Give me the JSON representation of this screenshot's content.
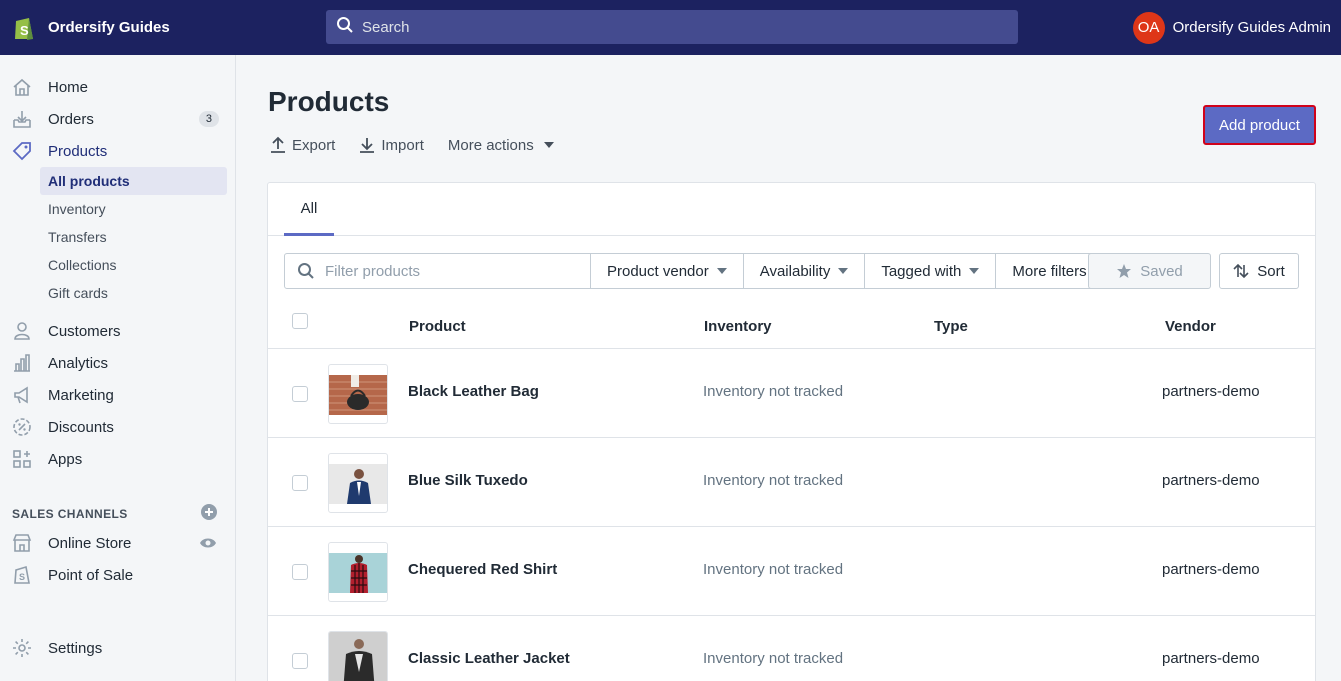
{
  "topbar": {
    "store_name": "Ordersify Guides",
    "search_placeholder": "Search",
    "avatar_initials": "OA",
    "user_name": "Ordersify Guides Admin"
  },
  "sidebar": {
    "items": [
      {
        "label": "Home",
        "icon": "home-icon"
      },
      {
        "label": "Orders",
        "icon": "orders-icon",
        "badge": "3"
      },
      {
        "label": "Products",
        "icon": "tag-icon"
      },
      {
        "label": "Customers",
        "icon": "person-icon"
      },
      {
        "label": "Analytics",
        "icon": "bar-chart-icon"
      },
      {
        "label": "Marketing",
        "icon": "megaphone-icon"
      },
      {
        "label": "Discounts",
        "icon": "discount-icon"
      },
      {
        "label": "Apps",
        "icon": "apps-icon"
      }
    ],
    "product_sub_items": [
      "All products",
      "Inventory",
      "Transfers",
      "Collections",
      "Gift cards"
    ],
    "sales_channels_title": "SALES CHANNELS",
    "channels": [
      {
        "label": "Online Store",
        "icon": "store-icon"
      },
      {
        "label": "Point of Sale",
        "icon": "pos-icon"
      }
    ],
    "settings_label": "Settings"
  },
  "main": {
    "title": "Products",
    "actions": {
      "export": "Export",
      "import": "Import",
      "more": "More actions"
    },
    "add_button": "Add product",
    "tab_all": "All",
    "filter_placeholder": "Filter products",
    "filters": [
      "Product vendor",
      "Availability",
      "Tagged with",
      "More filters"
    ],
    "saved_label": "Saved",
    "sort_label": "Sort",
    "columns": {
      "product": "Product",
      "inventory": "Inventory",
      "type": "Type",
      "vendor": "Vendor"
    },
    "rows": [
      {
        "name": "Black Leather Bag",
        "inventory": "Inventory not tracked",
        "type": "",
        "vendor": "partners-demo"
      },
      {
        "name": "Blue Silk Tuxedo",
        "inventory": "Inventory not tracked",
        "type": "",
        "vendor": "partners-demo"
      },
      {
        "name": "Chequered Red Shirt",
        "inventory": "Inventory not tracked",
        "type": "",
        "vendor": "partners-demo"
      },
      {
        "name": "Classic Leather Jacket",
        "inventory": "Inventory not tracked",
        "type": "",
        "vendor": "partners-demo"
      }
    ]
  },
  "colors": {
    "topbar": "#1c2260",
    "accent": "#5c6ac4",
    "highlight_border": "#d0021b",
    "avatar": "#de3618"
  }
}
